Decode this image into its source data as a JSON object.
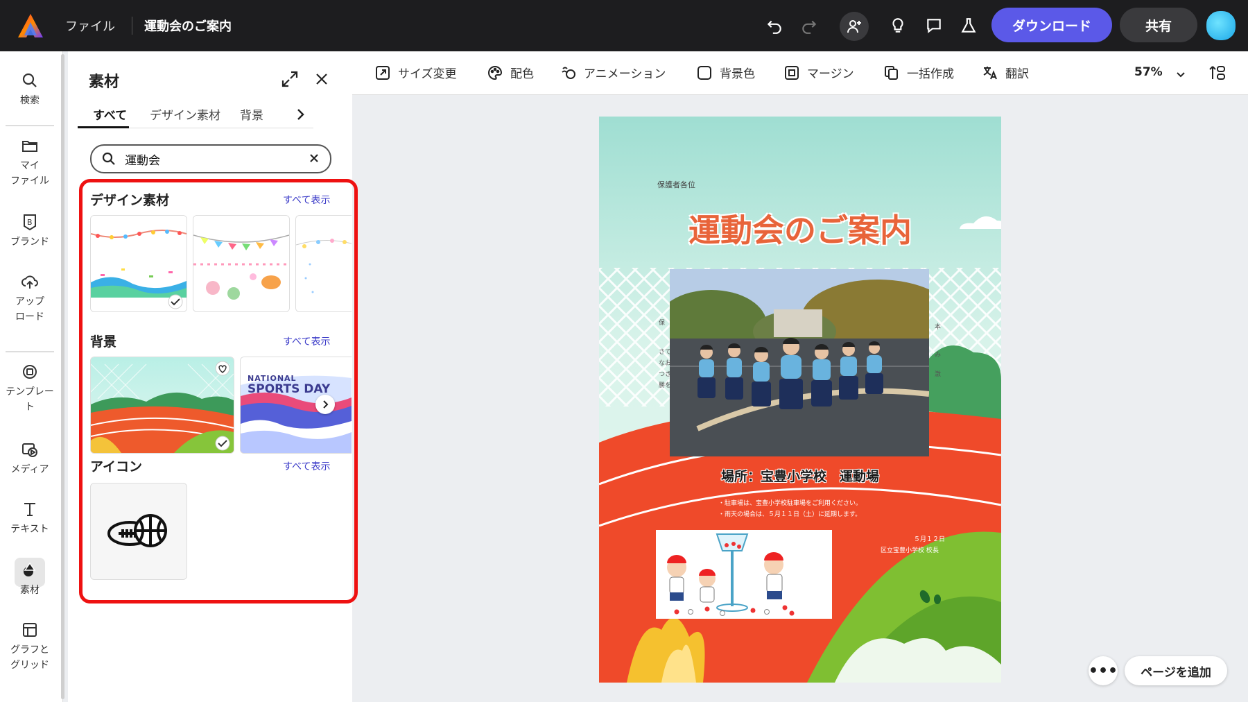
{
  "topbar": {
    "file_menu": "ファイル",
    "doc_title": "運動会のご案内",
    "download_label": "ダウンロード",
    "share_label": "共有"
  },
  "rail": {
    "items": [
      {
        "label": "検索"
      },
      {
        "label": "マイ\nファイル"
      },
      {
        "label": "ブランド"
      },
      {
        "label": "アップ\nロード"
      },
      {
        "label": "テンプレー\nト"
      },
      {
        "label": "メディア"
      },
      {
        "label": "テキスト"
      },
      {
        "label": "素材"
      },
      {
        "label": "グラフと\nグリッド"
      }
    ]
  },
  "panel": {
    "title": "素材",
    "tabs": [
      "すべて",
      "デザイン素材",
      "背景"
    ],
    "search_value": "運動会",
    "sections": {
      "design": {
        "title": "デザイン素材",
        "see_all": "すべて表示"
      },
      "background": {
        "title": "背景",
        "see_all": "すべて表示"
      },
      "icons": {
        "title": "アイコン",
        "see_all": "すべて表示"
      }
    },
    "bg_thumb_text": {
      "line1": "NATIONAL",
      "line2": "SPORTS DAY"
    }
  },
  "toolbar": {
    "resize": "サイズ変更",
    "color": "配色",
    "animation": "アニメーション",
    "bg_color": "背景色",
    "margin": "マージン",
    "bulk": "一括作成",
    "translate": "翻訳",
    "zoom": "57%"
  },
  "canvas": {
    "addressee": "保護者各位",
    "headline": "運動会のご案内",
    "venue": "場所：宝豊小学校　運動場",
    "note1": "・駐車場は、宝豊小学校駐車場をご利用ください。",
    "note2": "・雨天の場合は、５月１１日（土）に延期します。",
    "date": "５月１２日",
    "signature": "区立宝豊小学校 校長",
    "side_left": [
      "保",
      "さて",
      "なお",
      "つき",
      "勝を"
    ],
    "side_right": [
      "本",
      "み",
      "激"
    ]
  },
  "footer": {
    "more": "•••",
    "add_page": "ページを追加"
  },
  "colors": {
    "accent": "#5b59e8",
    "highlight": "#e11111",
    "track": "#ef4a2a",
    "headline": "#e8643a"
  }
}
